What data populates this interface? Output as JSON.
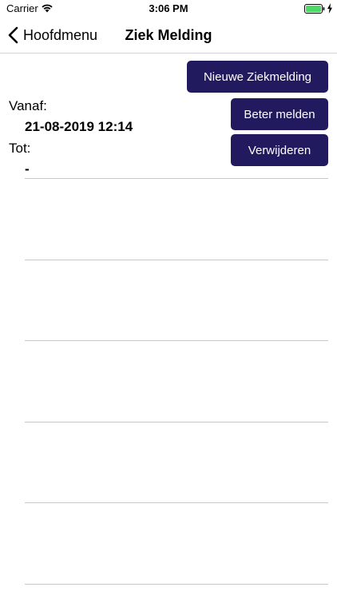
{
  "status_bar": {
    "carrier": "Carrier",
    "time": "3:06 PM",
    "icons": [
      "wifi-icon",
      "battery-icon",
      "charging-icon"
    ],
    "battery_color": "#4cd964"
  },
  "nav": {
    "back_label": "Hoofdmenu",
    "title": "Ziek Melding"
  },
  "actions": {
    "new_report": "Nieuwe Ziekmelding",
    "report_better": "Beter melden",
    "delete": "Verwijderen"
  },
  "details": {
    "from_label": "Vanaf:",
    "from_value": "21-08-2019 12:14",
    "to_label": "Tot:",
    "to_value": "-"
  },
  "colors": {
    "button_bg": "#211a5e",
    "button_text": "#ffffff",
    "separator": "#c8c7cc"
  }
}
